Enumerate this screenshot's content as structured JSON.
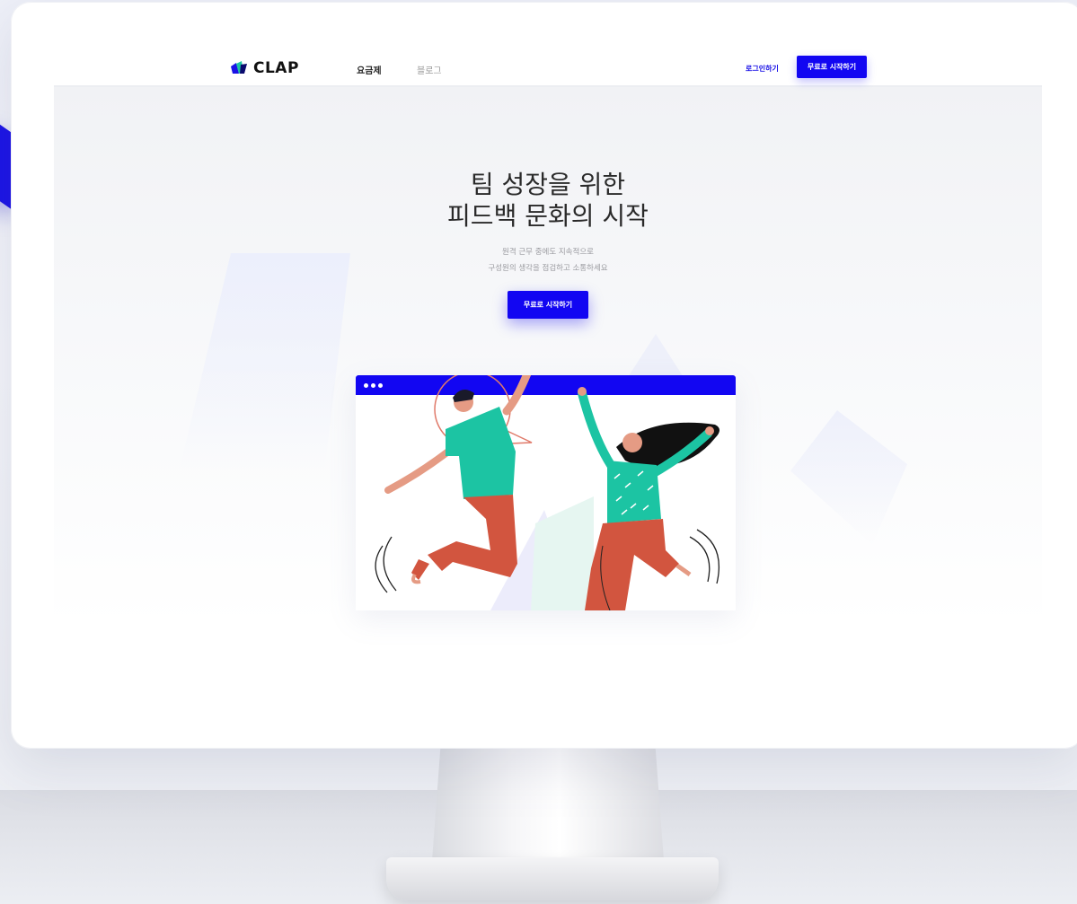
{
  "nav": {
    "logo_text": "CLAP",
    "links": [
      {
        "label": "요금제",
        "active": true
      },
      {
        "label": "블로그",
        "active": false
      }
    ],
    "login_label": "로그인하기",
    "cta_label": "무료로 시작하기"
  },
  "hero": {
    "title_line1": "팀 성장을 위한",
    "title_line2": "피드백 문화의 시작",
    "subtitle_line1": "원격 근무 중에도 지속적으로",
    "subtitle_line2": "구성원의 생각을 점검하고 소통하세요",
    "cta_label": "무료로 시작하기"
  },
  "colors": {
    "brand_blue": "#1206f2",
    "teal": "#1cc4a3",
    "coral": "#d2553f"
  },
  "icons": [
    "clap-logo-icon",
    "window-dots-icon"
  ]
}
